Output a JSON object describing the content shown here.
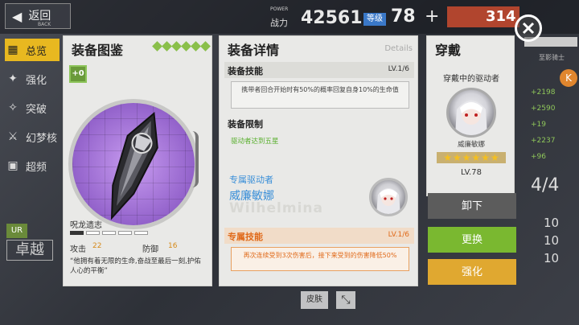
{
  "topbar": {
    "back_label": "返回",
    "back_sub": "BACK",
    "power_caption": "POWER",
    "power_label": "战力",
    "power_value": "42561",
    "level_tag": "等级",
    "level_value": "78",
    "level_plus": "+",
    "coins_value": "314"
  },
  "sidebar": {
    "items": [
      {
        "label": "总览",
        "icon": "grid-icon"
      },
      {
        "label": "强化",
        "icon": "wrench-icon"
      },
      {
        "label": "突破",
        "icon": "dna-icon"
      },
      {
        "label": "幻梦核",
        "icon": "sword-icon"
      },
      {
        "label": "超频",
        "icon": "chip-icon"
      }
    ],
    "rarity_badge": "UR",
    "rank": "卓越"
  },
  "right_bg": {
    "name": "至影骑士",
    "stats": [
      "+2198",
      "+2590",
      "+19",
      "+2237",
      "+96"
    ],
    "fraction": "4/4",
    "levels": [
      "10",
      "10",
      "10"
    ]
  },
  "codex": {
    "title": "装备图鉴",
    "plus_level": "+0",
    "equip_name": "呪龙遗志",
    "durability": {
      "filled": 1,
      "total": 5
    },
    "attack_label": "攻击",
    "attack_value": "22",
    "defense_label": "防御",
    "defense_value": "16",
    "quote": "“他拥有着无限的生命,奋战至最后一刻,护佑人心的平衡”"
  },
  "details": {
    "title": "装备详情",
    "title_en": "Details",
    "skill_title": "装备技能",
    "skill_level": "LV.1/6",
    "skill_text": "携带者回合开始时有50%的概率回复自身10%的生命值",
    "limit_title": "装备限制",
    "limit_text": "驱动者达到五星",
    "driver_label": "专属驱动者",
    "driver_name": "威廉敏娜",
    "driver_en": "Wilhelmina",
    "exclusive_title": "专属技能",
    "exclusive_level": "LV.1/6",
    "exclusive_text": "再次连续受到3次伤害后，接下来受到的伤害降低50%"
  },
  "equip_on": {
    "title": "穿戴",
    "subtitle": "穿戴中的驱动者",
    "driver_name": "威廉敏娜",
    "stars": 6,
    "level": "LV.78"
  },
  "actions": {
    "unequip": "卸下",
    "replace": "更换",
    "enhance": "强化"
  },
  "bottom": {
    "skin_label": "皮肤"
  },
  "colors": {
    "accent_green": "#7ab830",
    "accent_orange": "#e06a1a",
    "accent_blue": "#3a8fd8",
    "accent_gold": "#e0a830"
  }
}
